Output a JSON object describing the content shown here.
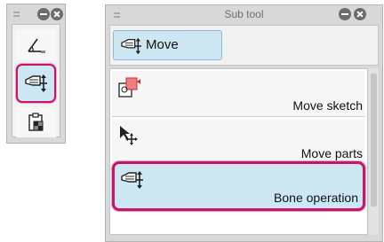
{
  "subtool": {
    "title": "Sub tool",
    "group_tab_label": "Move",
    "items": [
      {
        "label": "Move sketch"
      },
      {
        "label": "Move parts"
      },
      {
        "label": "Bone operation"
      }
    ]
  },
  "colors": {
    "highlight_border": "#c8156a",
    "selected_bg": "#cce6f2",
    "panel_bg": "#d8d8d8"
  },
  "icons": {
    "tool_panel": [
      "ruler-icon",
      "move-hand-icon",
      "layer-select-icon"
    ],
    "subtool_items": [
      "move-sketch-icon",
      "move-parts-icon",
      "bone-operation-icon"
    ]
  }
}
